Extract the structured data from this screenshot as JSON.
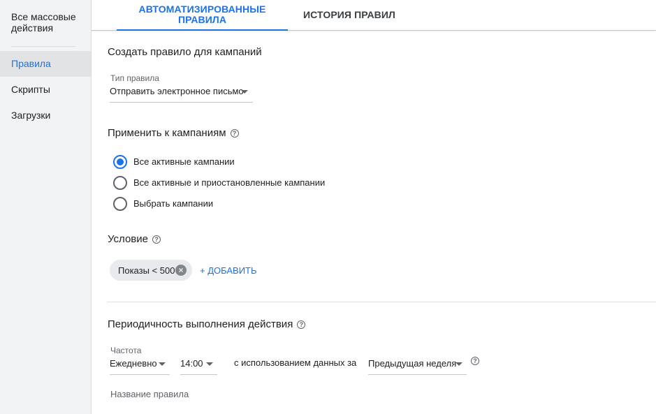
{
  "sidebar": {
    "title": "Все массовые действия",
    "items": [
      {
        "label": "Правила",
        "active": true
      },
      {
        "label": "Скрипты",
        "active": false
      },
      {
        "label": "Загрузки",
        "active": false
      }
    ]
  },
  "tabs": [
    {
      "label": "Автоматизированные правила",
      "active": true
    },
    {
      "label": "История правил",
      "active": false
    }
  ],
  "form": {
    "section_title": "Создать правило для кампаний",
    "rule_type": {
      "label": "Тип правила",
      "value": "Отправить электронное письмо"
    },
    "apply": {
      "title": "Применить к кампаниям",
      "options": [
        {
          "label": "Все активные кампании",
          "checked": true
        },
        {
          "label": "Все активные и приостановленные кампании",
          "checked": false
        },
        {
          "label": "Выбрать кампании",
          "checked": false
        }
      ]
    },
    "condition": {
      "title": "Условие",
      "chip": "Показы < 500",
      "add_label": "+ ДОБАВИТЬ"
    },
    "schedule": {
      "title": "Периодичность выполнения действия",
      "frequency_label": "Частота",
      "frequency_value": "Ежедневно",
      "time_value": "14:00",
      "using_data_text": "с использованием данных за",
      "period_value": "Предыдущая неделя"
    },
    "rule_name_placeholder": "Название правила"
  },
  "colors": {
    "accent": "#1a73e8",
    "sidebar_bg": "#f1f3f4",
    "sidebar_active_bg": "#e2e3e5",
    "chip_bg": "#e8eaed"
  },
  "icons": {
    "help": "help-circle-icon",
    "caret": "arrow-drop-down-icon",
    "chip_remove": "cancel-circle-icon"
  }
}
